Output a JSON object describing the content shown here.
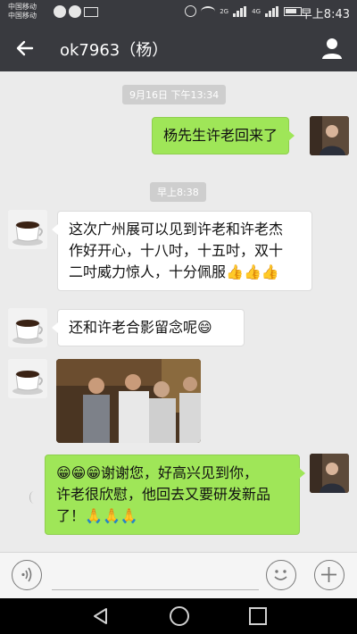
{
  "status_bar": {
    "carrier_1": "中国移动",
    "carrier_2": "中国移动",
    "network_1": "2G",
    "network_2": "4G",
    "time": "早上8:43"
  },
  "title_bar": {
    "title": "ok7963（杨）"
  },
  "messages": [
    {
      "type": "timestamp",
      "text": "9月16日 下午13:34"
    },
    {
      "type": "outgoing",
      "text": "杨先生许老回来了"
    },
    {
      "type": "timestamp",
      "text": "早上8:38"
    },
    {
      "type": "incoming",
      "lines": [
        "这次广州展可以见到许老和许老杰",
        "作好开心，十八吋，十五吋，双十",
        "二吋威力惊人，十分佩服"
      ],
      "emoji": "👍👍👍"
    },
    {
      "type": "incoming",
      "text": "还和许老合影留念呢",
      "emoji": "😄"
    },
    {
      "type": "incoming_image",
      "description": "group photo"
    },
    {
      "type": "outgoing",
      "lines_emoji": "😁😁😁",
      "lines": [
        "谢谢您，好高兴见到你，",
        "许老很欣慰，他回去又要研发新品",
        "了！"
      ],
      "trail_emoji": "🙏🙏🙏"
    }
  ],
  "input_bar": {
    "placeholder": ""
  },
  "icons": {
    "back": "arrow-left-icon",
    "contact": "person-icon",
    "voice": "voice-icon",
    "emoji": "smiley-icon",
    "plus": "plus-icon"
  },
  "colors": {
    "header": "#393a3f",
    "background": "#ebebeb",
    "outgoing_bubble": "#9fe658",
    "incoming_bubble": "#ffffff"
  }
}
